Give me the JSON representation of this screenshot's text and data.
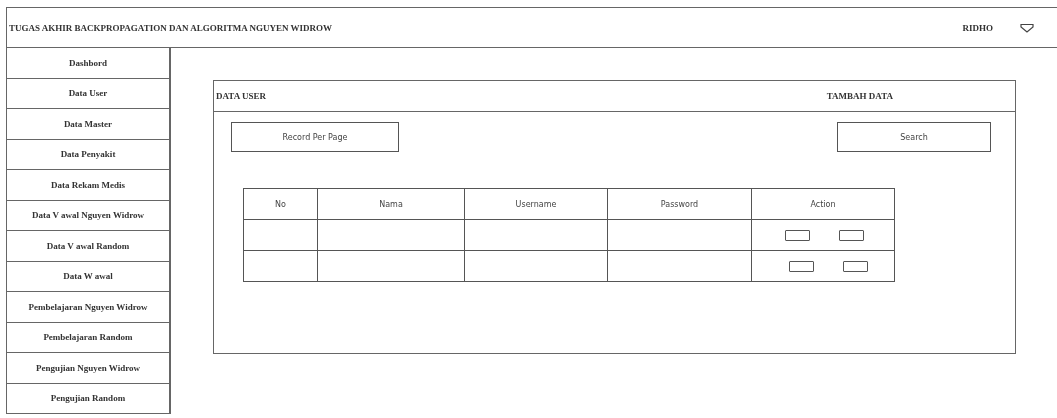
{
  "header": {
    "title": "TUGAS AKHIR BACKPROPAGATION DAN ALGORITMA NGUYEN WIDROW",
    "user": "RIDHO"
  },
  "sidebar": {
    "items": [
      {
        "label": "Dashbord"
      },
      {
        "label": "Data User"
      },
      {
        "label": "Data Master"
      },
      {
        "label": "Data Penyakit"
      },
      {
        "label": "Data Rekam Medis"
      },
      {
        "label": "Data V awal Nguyen Widrow"
      },
      {
        "label": "Data V awal Random"
      },
      {
        "label": "Data W awal"
      },
      {
        "label": "Pembelajaran Nguyen Widrow"
      },
      {
        "label": "Pembelajaran Random"
      },
      {
        "label": "Pengujian Nguyen Widrow"
      },
      {
        "label": "Pengujian Random"
      }
    ]
  },
  "panel": {
    "title": "DATA USER",
    "add_button": "TAMBAH DATA",
    "record_per_page": "Record Per Page",
    "search": "Search",
    "table": {
      "columns": [
        "No",
        "Nama",
        "Username",
        "Password",
        "Action"
      ],
      "rows": [
        {
          "kind": "blank"
        },
        {
          "kind": "blank"
        }
      ]
    }
  }
}
